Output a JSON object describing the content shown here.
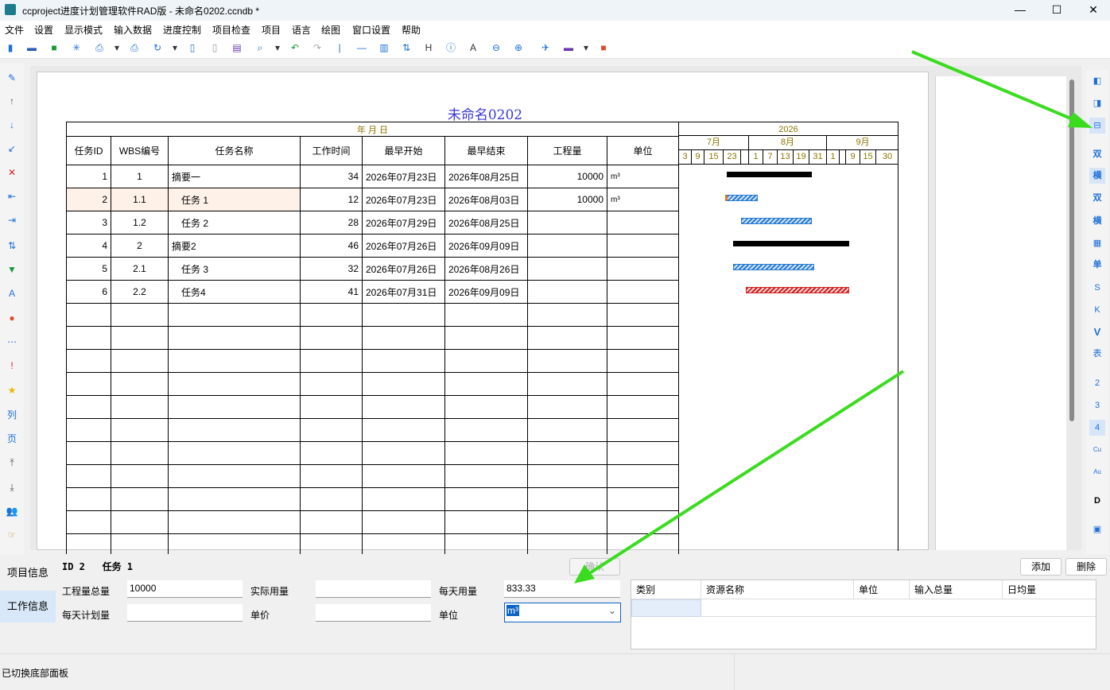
{
  "window": {
    "title": "ccproject进度计划管理软件RAD版 - 未命名0202.ccndb *",
    "minimize": "—",
    "maximize": "☐",
    "close": "✕"
  },
  "menu": [
    "文件",
    "设置",
    "显示模式",
    "输入数据",
    "进度控制",
    "项目检查",
    "项目",
    "语言",
    "绘图",
    "窗口设置",
    "帮助"
  ],
  "document": {
    "title": "未命名0202",
    "date_header": "年 月 日",
    "columns": [
      "任务ID",
      "WBS编号",
      "任务名称",
      "工作时间",
      "最早开始",
      "最早结束",
      "工程量",
      "单位"
    ],
    "rows": [
      {
        "id": "1",
        "wbs": "1",
        "name": "摘要一",
        "duration": "34",
        "start": "2026年07月23日",
        "end": "2026年08月25日",
        "qty": "10000",
        "unit": "m³"
      },
      {
        "id": "2",
        "wbs": "1.1",
        "name": "任务 1",
        "duration": "12",
        "start": "2026年07月23日",
        "end": "2026年08月03日",
        "qty": "10000",
        "unit": "m³"
      },
      {
        "id": "3",
        "wbs": "1.2",
        "name": "任务 2",
        "duration": "28",
        "start": "2026年07月29日",
        "end": "2026年08月25日",
        "qty": "",
        "unit": ""
      },
      {
        "id": "4",
        "wbs": "2",
        "name": "摘要2",
        "duration": "46",
        "start": "2026年07月26日",
        "end": "2026年09月09日",
        "qty": "",
        "unit": ""
      },
      {
        "id": "5",
        "wbs": "2.1",
        "name": "任务 3",
        "duration": "32",
        "start": "2026年07月26日",
        "end": "2026年08月26日",
        "qty": "",
        "unit": ""
      },
      {
        "id": "6",
        "wbs": "2.2",
        "name": "任务4",
        "duration": "41",
        "start": "2026年07月31日",
        "end": "2026年09月09日",
        "qty": "",
        "unit": ""
      }
    ]
  },
  "gantt": {
    "year": "2026",
    "months": [
      "7月",
      "8月",
      "9月"
    ],
    "days": [
      "3",
      "9",
      "15",
      "23",
      "1",
      "7",
      "13",
      "19",
      "31",
      "1",
      "9",
      "15",
      "30"
    ]
  },
  "right_tools": [
    "双",
    "横",
    "双",
    "横",
    "单",
    "S",
    "K",
    "V",
    "表",
    "2",
    "3",
    "4",
    "Cu",
    "Au",
    "D"
  ],
  "left_tools": [
    "列",
    "页"
  ],
  "bottom_panel": {
    "tabs": [
      "项目信息",
      "工作信息"
    ],
    "selected_task": "ID 2   任务 1",
    "confirm_label": "确认",
    "add_label": "添加",
    "delete_label": "删除",
    "fields": {
      "total_qty_label": "工程量总量",
      "total_qty_value": "10000",
      "actual_label": "实际用量",
      "actual_value": "",
      "daily_label": "每天用量",
      "daily_value": "833.33",
      "plan_label": "每天计划量",
      "plan_value": "",
      "price_label": "单价",
      "price_value": "",
      "unit_label": "单位",
      "unit_value": "m³"
    },
    "resource_columns": [
      "类别",
      "资源名称",
      "单位",
      "输入总量",
      "日均量"
    ]
  },
  "status": "已切换底部面板"
}
